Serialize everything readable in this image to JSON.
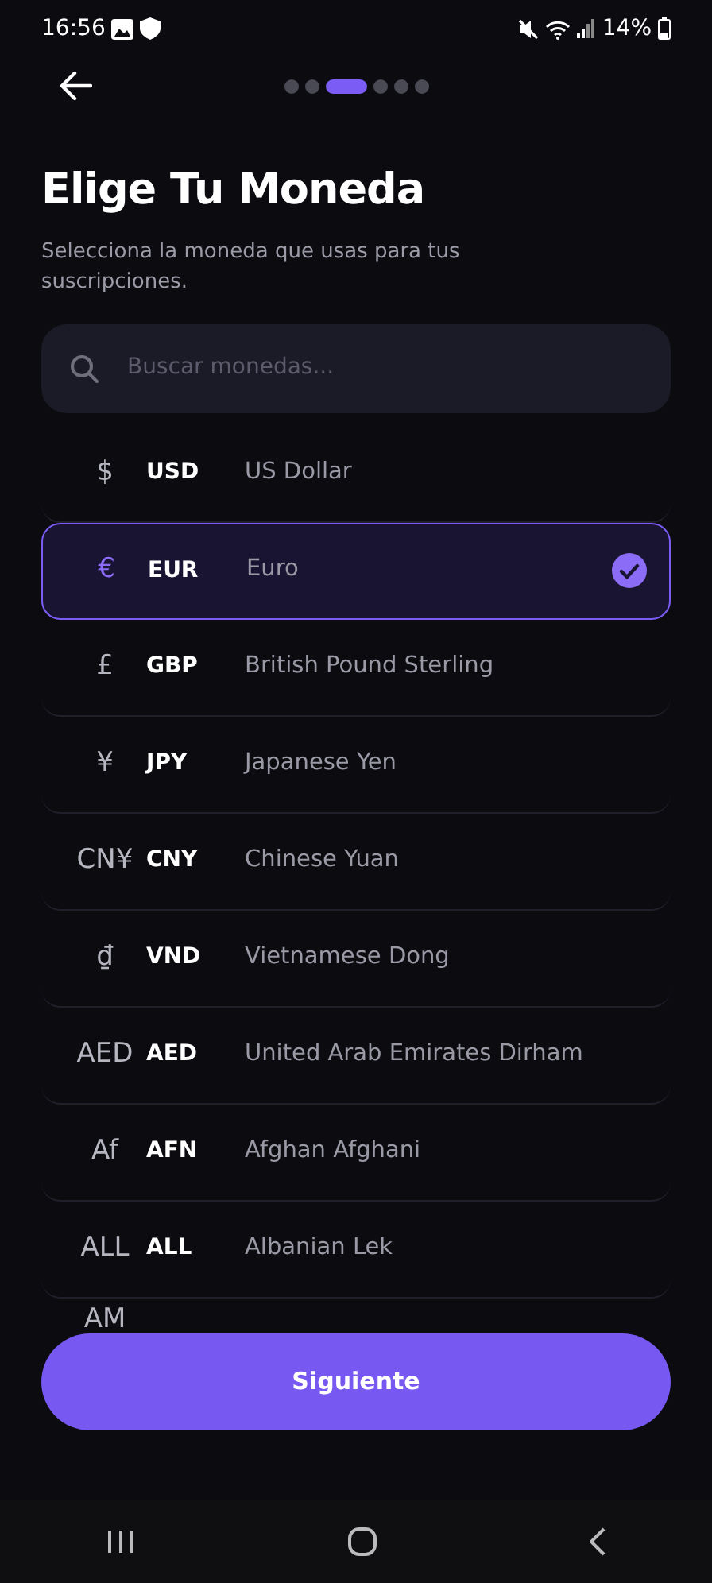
{
  "status_bar": {
    "time": "16:56",
    "battery": "14%"
  },
  "progress": [
    {
      "selected": false
    },
    {
      "selected": false
    },
    {
      "selected": true
    },
    {
      "selected": false
    },
    {
      "selected": false
    },
    {
      "selected": false
    }
  ],
  "title": "Elige Tu Moneda",
  "subtitle": "Selecciona la moneda que usas para tus suscripciones.",
  "search": {
    "placeholder": "Buscar monedas..."
  },
  "currencies": [
    {
      "symbol": "$",
      "code": "USD",
      "name": "US Dollar",
      "selected": false
    },
    {
      "symbol": "€",
      "code": "EUR",
      "name": "Euro",
      "selected": true
    },
    {
      "symbol": "£",
      "code": "GBP",
      "name": "British Pound Sterling",
      "selected": false
    },
    {
      "symbol": "¥",
      "code": "JPY",
      "name": "Japanese Yen",
      "selected": false
    },
    {
      "symbol": "CN¥",
      "code": "CNY",
      "name": "Chinese Yuan",
      "selected": false
    },
    {
      "symbol": "₫",
      "code": "VND",
      "name": "Vietnamese Dong",
      "selected": false
    },
    {
      "symbol": "AED",
      "code": "AED",
      "name": "United Arab Emirates Dirham",
      "selected": false
    },
    {
      "symbol": "Af",
      "code": "AFN",
      "name": "Afghan Afghani",
      "selected": false
    },
    {
      "symbol": "ALL",
      "code": "ALL",
      "name": "Albanian Lek",
      "selected": false
    },
    {
      "symbol": "AM",
      "selected": false
    }
  ],
  "next_button": "Siguiente"
}
